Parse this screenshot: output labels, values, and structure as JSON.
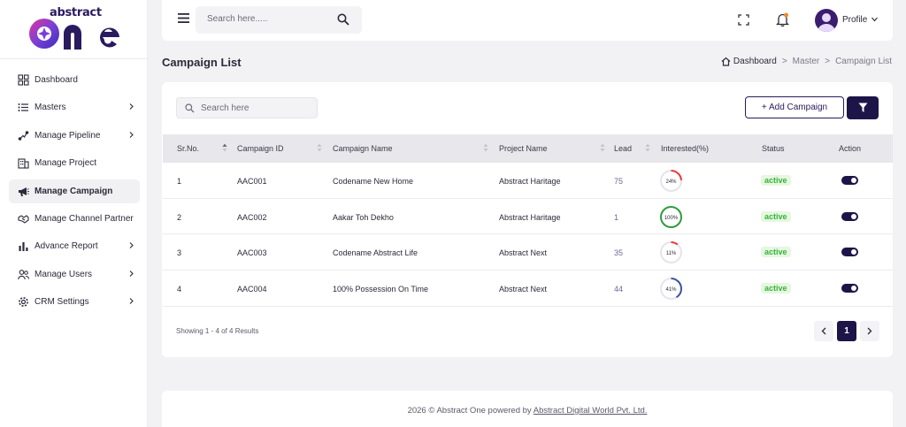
{
  "brand": {
    "top": "abstract",
    "main": "one"
  },
  "sidebar": {
    "items": [
      {
        "label": "Dashboard",
        "icon": "grid-icon",
        "chevron": false,
        "active": false
      },
      {
        "label": "Masters",
        "icon": "list-icon",
        "chevron": true,
        "active": false
      },
      {
        "label": "Manage Pipeline",
        "icon": "pipeline-icon",
        "chevron": true,
        "active": false
      },
      {
        "label": "Manage Project",
        "icon": "building-icon",
        "chevron": false,
        "active": false
      },
      {
        "label": "Manage Campaign",
        "icon": "megaphone-icon",
        "chevron": false,
        "active": true
      },
      {
        "label": "Manage Channel Partner",
        "icon": "handshake-icon",
        "chevron": false,
        "active": false
      },
      {
        "label": "Advance Report",
        "icon": "bar-chart-icon",
        "chevron": true,
        "active": false
      },
      {
        "label": "Manage Users",
        "icon": "users-icon",
        "chevron": true,
        "active": false
      },
      {
        "label": "CRM Settings",
        "icon": "gear-icon",
        "chevron": true,
        "active": false
      }
    ]
  },
  "topbar": {
    "search_placeholder": "Search here.....",
    "profile_label": "Profile"
  },
  "page": {
    "title": "Campaign List",
    "breadcrumb": [
      "Dashboard",
      "Master",
      "Campaign List"
    ]
  },
  "card": {
    "search_placeholder": "Search here",
    "add_button": "+ Add Campaign"
  },
  "table": {
    "headers": [
      "Sr.No.",
      "Campaign ID",
      "Campaign Name",
      "Project Name",
      "Lead",
      "Interested(%)",
      "Status",
      "Action"
    ],
    "rows": [
      {
        "sr": "1",
        "id": "AAC001",
        "name": "Codename New Home",
        "project": "Abstract Haritage",
        "lead": "75",
        "interested": 24,
        "interested_label": "24%",
        "status": "active"
      },
      {
        "sr": "2",
        "id": "AAC002",
        "name": "Aakar Toh Dekho",
        "project": "Abstract Haritage",
        "lead": "1",
        "interested": 100,
        "interested_label": "100%",
        "status": "active"
      },
      {
        "sr": "3",
        "id": "AAC003",
        "name": "Codename Abstract Life",
        "project": "Abstract Next",
        "lead": "35",
        "interested": 11,
        "interested_label": "11%",
        "status": "active"
      },
      {
        "sr": "4",
        "id": "AAC004",
        "name": "100% Possession On Time",
        "project": "Abstract Next",
        "lead": "44",
        "interested": 41,
        "interested_label": "41%",
        "status": "active"
      }
    ]
  },
  "pagination": {
    "summary": "Showing 1 - 4 of 4 Results",
    "current": "1"
  },
  "footer": {
    "text": "2026 © Abstract One powered by ",
    "link": "Abstract Digital World Pvt. Ltd."
  },
  "colors": {
    "primary": "#1d1548",
    "active_green": "#34b53a",
    "progress_red": "#e53935",
    "progress_green": "#2e9e3a",
    "progress_blue": "#3a55a0"
  }
}
